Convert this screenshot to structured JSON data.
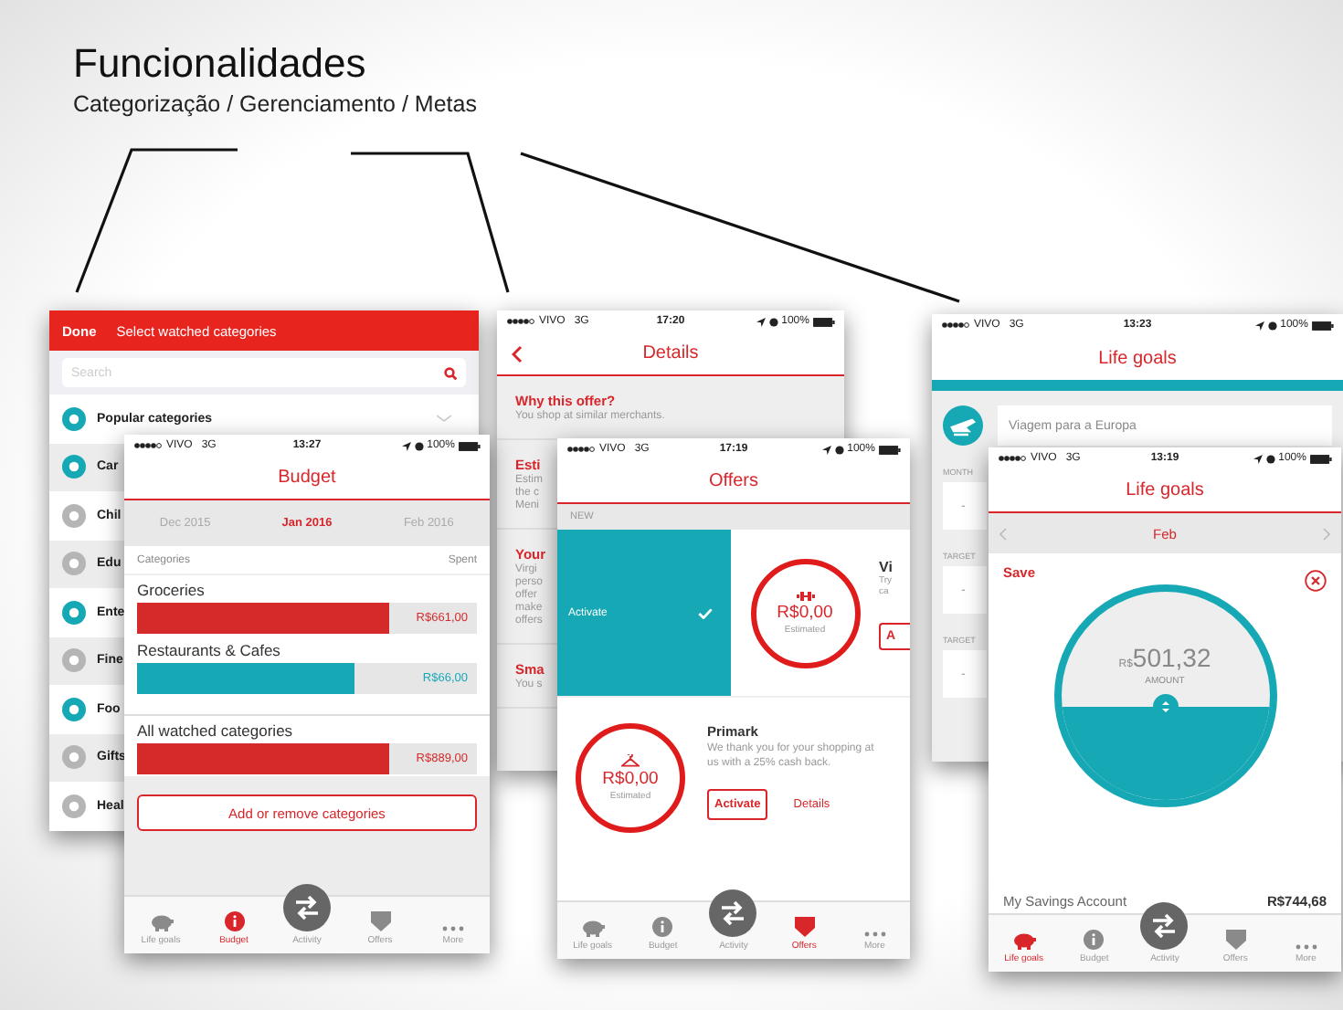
{
  "slide": {
    "title": "Funcionalidades",
    "subtitle": "Categorização / Gerenciamento / Metas"
  },
  "category_screen": {
    "done": "Done",
    "title": "Select watched categories",
    "search": {
      "placeholder": "Search"
    },
    "items": [
      {
        "label": "Popular categories",
        "color": "#17a8b5"
      },
      {
        "label": "Car",
        "color": "#17a8b5"
      },
      {
        "label": "Chil",
        "color": "#b5b5b5"
      },
      {
        "label": "Edu",
        "color": "#b5b5b5"
      },
      {
        "label": "Ente",
        "color": "#17a8b5"
      },
      {
        "label": "Fine",
        "color": "#b5b5b5"
      },
      {
        "label": "Foo",
        "color": "#17a8b5"
      },
      {
        "label": "Gifts",
        "color": "#b5b5b5"
      },
      {
        "label": "Heal",
        "color": "#b5b5b5"
      }
    ]
  },
  "details_screen": {
    "status_bar": {
      "carrier": "VIVO",
      "network": "3G",
      "time": "17:20",
      "battery": "100%"
    },
    "title": "Details",
    "sections": [
      {
        "heading": "Why this offer?",
        "lines": [
          "You shop at similar merchants."
        ]
      },
      {
        "heading": "Esti",
        "lines": [
          "Estim",
          "the c",
          "Meni"
        ]
      },
      {
        "heading": "Your",
        "lines": [
          "Virgi",
          "perso",
          "offer",
          "make",
          "offers"
        ]
      },
      {
        "heading": "Sma",
        "lines": [
          "You s"
        ]
      }
    ]
  },
  "goal_form_screen": {
    "status_bar": {
      "carrier": "VIVO",
      "network": "3G",
      "time": "13:23",
      "battery": "100%"
    },
    "title": "Life goals",
    "goal_name": "Viagem para a Europa",
    "fields": [
      {
        "label": "MONTH",
        "value": "-"
      },
      {
        "label": "TARGET",
        "value": "-"
      },
      {
        "label": "TARGET",
        "value": "-"
      }
    ]
  },
  "budget_screen": {
    "status_bar": {
      "carrier": "VIVO",
      "network": "3G",
      "time": "13:27",
      "battery": "100%"
    },
    "title": "Budget",
    "months": [
      {
        "label": "Dec 2015",
        "selected": false
      },
      {
        "label": "Jan 2016",
        "selected": true
      },
      {
        "label": "Feb 2016",
        "selected": false
      }
    ],
    "columns": [
      "Categories",
      "Spent"
    ],
    "rows": [
      {
        "name": "Groceries",
        "amount": "R$661,00",
        "level": 0.74,
        "color": "#d42a2a"
      },
      {
        "name": "Restaurants & Cafes",
        "amount": "R$66,00",
        "level": 0.64,
        "color": "#17a8b5"
      }
    ],
    "total": {
      "name": "All watched categories",
      "amount": "R$889,00",
      "level": 0.74,
      "color": "#d42a2a"
    },
    "button": "Add or remove categories",
    "tabs": [
      {
        "label": "Life goals",
        "selected": false
      },
      {
        "label": "Budget",
        "selected": true
      },
      {
        "label": "Activity",
        "selected": false
      },
      {
        "label": "Offers",
        "selected": false
      },
      {
        "label": "More",
        "selected": false
      }
    ]
  },
  "offers_screen": {
    "status_bar": {
      "carrier": "VIVO",
      "network": "3G",
      "time": "17:19",
      "battery": "100%"
    },
    "title": "Offers",
    "section": "NEW",
    "swiped_offer": {
      "action": "Activate",
      "amount": "R$0,00",
      "caption": "Estimated",
      "name": "Vi",
      "lines": [
        "Try",
        "ca"
      ],
      "button": "A"
    },
    "offer": {
      "name": "Primark",
      "text": "We thank you for your shopping at us with a 25% cash back.",
      "amount": "R$0,00",
      "caption": "Estimated",
      "activate": "Activate",
      "details": "Details"
    },
    "tabs": [
      {
        "label": "Life goals",
        "selected": false
      },
      {
        "label": "Budget",
        "selected": false
      },
      {
        "label": "Activity",
        "selected": false
      },
      {
        "label": "Offers",
        "selected": true
      },
      {
        "label": "More",
        "selected": false
      }
    ]
  },
  "goal_screen": {
    "status_bar": {
      "carrier": "VIVO",
      "network": "3G",
      "time": "13:19",
      "battery": "100%"
    },
    "title": "Life goals",
    "month": "Feb",
    "save": "Save",
    "currency": "R$",
    "amount": "501,32",
    "amount_label": "AMOUNT",
    "level": 0.45,
    "account": "My Savings Account",
    "balance": "R$744,68",
    "tabs": [
      {
        "label": "Life goals",
        "selected": true
      },
      {
        "label": "Budget",
        "selected": false
      },
      {
        "label": "Activity",
        "selected": false
      },
      {
        "label": "Offers",
        "selected": false
      },
      {
        "label": "More",
        "selected": false
      }
    ]
  }
}
